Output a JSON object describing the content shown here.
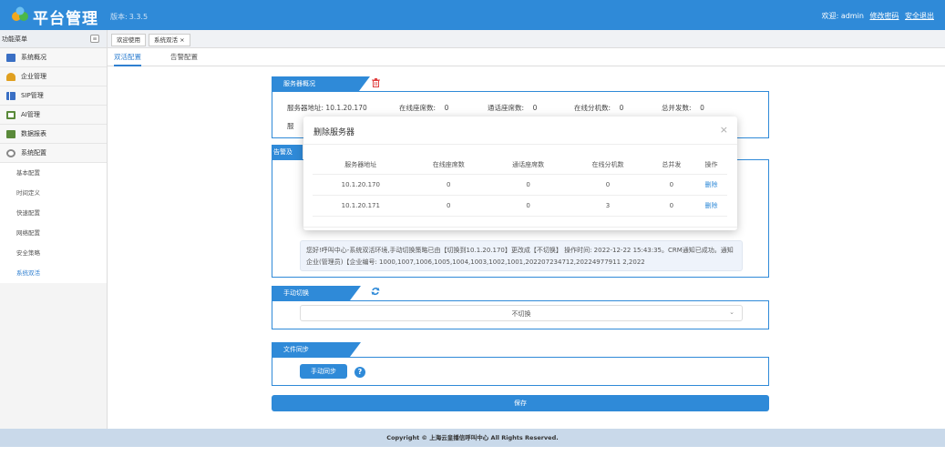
{
  "header": {
    "title": "平台管理",
    "version_label": "版本:",
    "version": "3.3.5",
    "welcome": "欢迎: admin",
    "change_password": "修改密码",
    "logout": "安全退出"
  },
  "sidebar": {
    "title": "功能菜单",
    "collapse_icon": "≡",
    "items": [
      {
        "label": "系统概况",
        "icon": "monitor-icon",
        "color": "#3a6fc4"
      },
      {
        "label": "企业管理",
        "icon": "user-icon",
        "color": "#e0a020"
      },
      {
        "label": "SIP管理",
        "icon": "bar-chart-icon",
        "color": "#3a6fc4"
      },
      {
        "label": "AI管理",
        "icon": "panel-icon",
        "color": "#5a8a3a"
      },
      {
        "label": "数据报表",
        "icon": "table-icon",
        "color": "#5a8a3a"
      },
      {
        "label": "系统配置",
        "icon": "gear-icon",
        "color": "#888888"
      }
    ],
    "sub_items": [
      "基本配置",
      "时间定义",
      "快速配置",
      "网络配置",
      "安全策略",
      "系统双活"
    ]
  },
  "tabs": {
    "welcome": "欢迎使用",
    "active": "系统双活 ×"
  },
  "subtabs": {
    "active": "双活配置",
    "other": "告警配置"
  },
  "server_section": {
    "title": "服务器概况",
    "row": {
      "addr_label": "服务器地址:",
      "addr": "10.1.20.170",
      "online_label": "在线座席数:",
      "online": "0",
      "calling_label": "通话座席数:",
      "calling": "0",
      "ext_label": "在线分机数:",
      "ext": "0",
      "conc_label": "总并发数:",
      "conc": "0"
    },
    "row2_fragment": "服"
  },
  "alert_section": {
    "title": "告警及",
    "message": "您好!呼叫中心-系统双活环境,手动切换策略已由【切换到10.1.20.170】更改成【不切换】 操作时间: 2022-12-22 15:43:35。CRM通知已成功。通知企业(管理员)【企业编号: 1000,1007,1006,1005,1004,1003,1002,1001,202207234712,20224977911 2,2022"
  },
  "manual_section": {
    "title": "手动切换",
    "select_value": "不切换"
  },
  "file_section": {
    "title": "文件同步",
    "button": "手动同步",
    "help": "?"
  },
  "save_button": "保存",
  "footer": "Copyright © 上海云皇播信呼叫中心 All Rights Reserved.",
  "modal": {
    "title": "删除服务器",
    "close": "×",
    "columns": [
      "服务器地址",
      "在线座席数",
      "通话座席数",
      "在线分机数",
      "总并发",
      "操作"
    ],
    "rows": [
      [
        "10.1.20.170",
        "0",
        "0",
        "0",
        "0",
        "删除"
      ],
      [
        "10.1.20.171",
        "0",
        "0",
        "3",
        "0",
        "删除"
      ]
    ]
  }
}
